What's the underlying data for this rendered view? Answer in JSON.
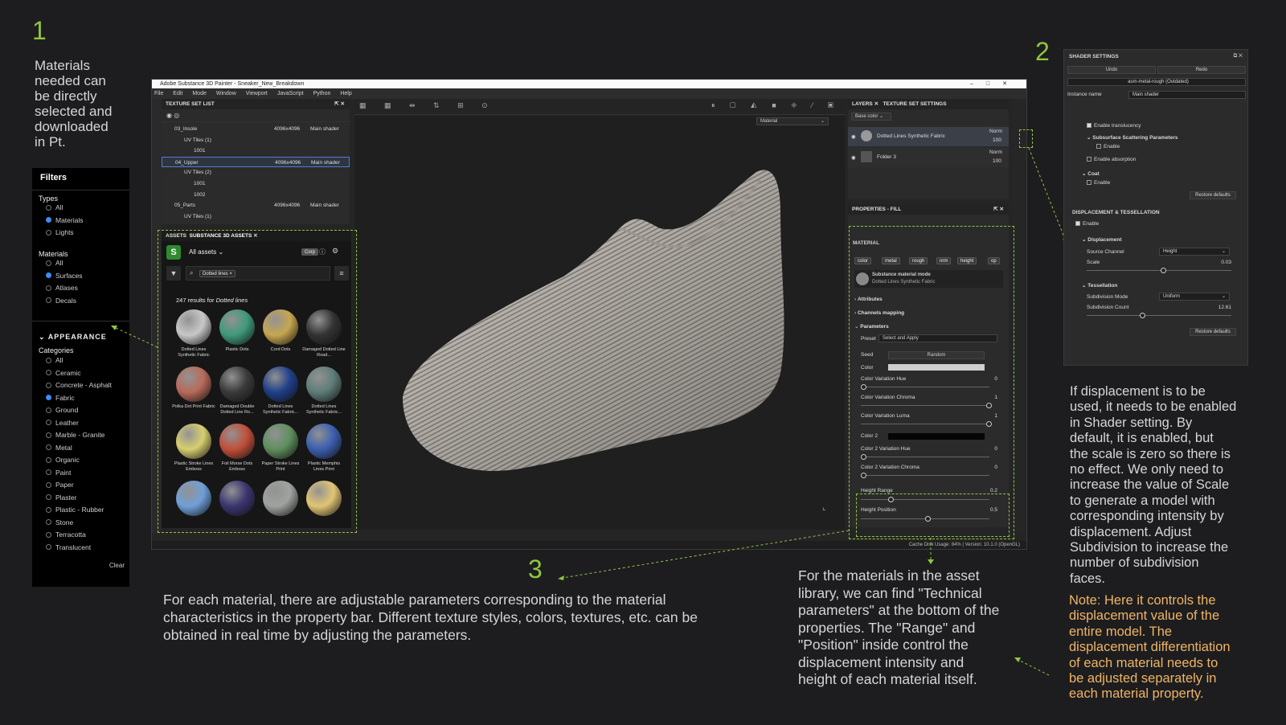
{
  "annot": {
    "n1": "1",
    "n2": "2",
    "n3": "3",
    "c1": [
      "Materials",
      "needed can",
      "be directly",
      "selected and",
      "downloaded",
      "in Pt."
    ],
    "c3": [
      "For each material, there are adjustable parameters corresponding to the material",
      "characteristics in the property bar. Different texture styles, colors, textures, etc. can be",
      "obtained in real time by adjusting the parameters."
    ],
    "c4": [
      "For the materials in the asset",
      "library, we can find \"Technical",
      "parameters\" at the bottom of the",
      "properties. The \"Range\" and",
      "\"Position\" inside control the",
      "displacement intensity and",
      "height of each material itself."
    ],
    "c2": [
      "If displacement is to be",
      "used, it needs to be enabled",
      "in Shader setting. By",
      "default, it is enabled, but",
      "the scale is zero so there is",
      "no effect. We only need to",
      "increase the value of Scale",
      "to generate a model with",
      "corresponding intensity by",
      "displacement. Adjust",
      "Subdivision to increase the",
      "number of subdivision",
      "faces."
    ],
    "note": [
      "Note: Here it controls the",
      "displacement value of the",
      "entire model. The",
      "displacement differentiation",
      "of each material needs to",
      "be adjusted separately in",
      "each material property."
    ]
  },
  "filters": {
    "title": "Filters",
    "types_h": "Types",
    "types": [
      "All",
      "Materials",
      "Lights"
    ],
    "mat_h": "Materials",
    "mats": [
      "All",
      "Surfaces",
      "Atlases",
      "Decals"
    ],
    "app_h": "APPEARANCE",
    "cat_h": "Categories",
    "cats": [
      "All",
      "Ceramic",
      "Concrete - Asphalt",
      "Fabric",
      "Ground",
      "Leather",
      "Marble - Granite",
      "Metal",
      "Organic",
      "Paint",
      "Paper",
      "Plaster",
      "Plastic - Rubber",
      "Stone",
      "Terracotta",
      "Translucent"
    ],
    "clear": "Clear"
  },
  "app": {
    "title": "Adobe Substance 3D Painter - Sneaker_New_Breakdown",
    "menus": [
      "File",
      "Edit",
      "Mode",
      "Window",
      "Viewport",
      "JavaScript",
      "Python",
      "Help"
    ],
    "tsl": {
      "title": "TEXTURE SET LIST",
      "rows": [
        [
          "03_Insole",
          "4096x4096",
          "Main shader"
        ],
        [
          "UV Tiles (1)",
          "",
          ""
        ],
        [
          "1001",
          "",
          ""
        ],
        [
          "04_Upper",
          "4096x4096",
          "Main shader"
        ],
        [
          "UV Tiles (2)",
          "",
          ""
        ],
        [
          "1001",
          "",
          ""
        ],
        [
          "1002",
          "",
          ""
        ],
        [
          "05_Parts",
          "4096x4096",
          "Main shader"
        ],
        [
          "UV Tiles (1)",
          "",
          ""
        ]
      ]
    },
    "assets": {
      "tab1": "ASSETS",
      "tab2": "SUBSTANCE 3D ASSETS",
      "all": "All assets",
      "corp": "Corp",
      "search": "Dotted lines",
      "results": "247 results for ",
      "query": "Dotted lines",
      "items": [
        "Dotted Lines Synthetic Fabric",
        "Plastic Dots",
        "Cord Dots",
        "Damaged Dotted Line Road...",
        "Polka Dot Print Fabric",
        "Damaged Double Dotted Line Ro...",
        "Dotted Lines Synthetic Fabric...",
        "Dotted Lines Synthetic Fabric...",
        "Plastic Stroke Lines Emboss",
        "Foil Morse Dots Emboss",
        "Paper Stroke Lines Print",
        "Plastic Memphis Lines Print",
        "",
        "",
        "",
        ""
      ]
    },
    "viewport": {
      "mode": "Material"
    },
    "layers": {
      "tab1": "LAYERS",
      "tab2": "TEXTURE SET SETTINGS",
      "channel": "Base color",
      "items": [
        {
          "name": "Dotted Lines Synthetic Fabric",
          "blend": "Norm",
          "op": "100"
        },
        {
          "name": "Folder 3",
          "blend": "Norm",
          "op": "100"
        }
      ]
    },
    "props": {
      "title": "PROPERTIES - FILL",
      "mat": "MATERIAL",
      "chans": [
        "color",
        "metal",
        "rough",
        "nrm",
        "height",
        "op"
      ],
      "mode": "Substance material mode",
      "modesub": "Dotted Lines Synthetic Fabric",
      "attrs": "Attributes",
      "chmap": "Channels mapping",
      "params": "Parameters",
      "preset": "Preset",
      "presetv": "Select and Apply",
      "seed": "Seed",
      "seedv": "Random",
      "color": "Color",
      "sliders": [
        {
          "l": "Color Variation Hue",
          "v": "0"
        },
        {
          "l": "Color Variation Chroma",
          "v": "1"
        },
        {
          "l": "Color Variation Luma",
          "v": "1"
        }
      ],
      "color2": "Color 2",
      "sliders2": [
        {
          "l": "Color 2 Variation Hue",
          "v": "0"
        },
        {
          "l": "Color 2 Variation Chroma",
          "v": "0"
        }
      ],
      "hr": "Height Range",
      "hrv": "0.2",
      "hp": "Height Position",
      "hpv": "0.5"
    },
    "status": "Cache Disk Usage:   84% | Version: 10.1.0 (OpenGL)"
  },
  "shader": {
    "title": "SHADER SETTINGS",
    "undo": "Undo",
    "redo": "Redo",
    "preset": "asm-metal-rough (Outdated)",
    "iname": "Instance name",
    "inamev": "Main shader",
    "trans": "Enable translucency",
    "sss": "Subsurface Scattering Parameters",
    "en": "Enable",
    "abs": "Enable absorption",
    "coat": "Coat",
    "restore": "Restore defaults",
    "dt": "DISPLACEMENT & TESSELLATION",
    "disp": "Displacement",
    "src": "Source Channel",
    "srcv": "Height",
    "scale": "Scale",
    "scalev": "0.03",
    "tess": "Tessellation",
    "sm": "Subdivision Mode",
    "smv": "Uniform",
    "sc": "Subdivision Count",
    "scv": "12.61"
  }
}
